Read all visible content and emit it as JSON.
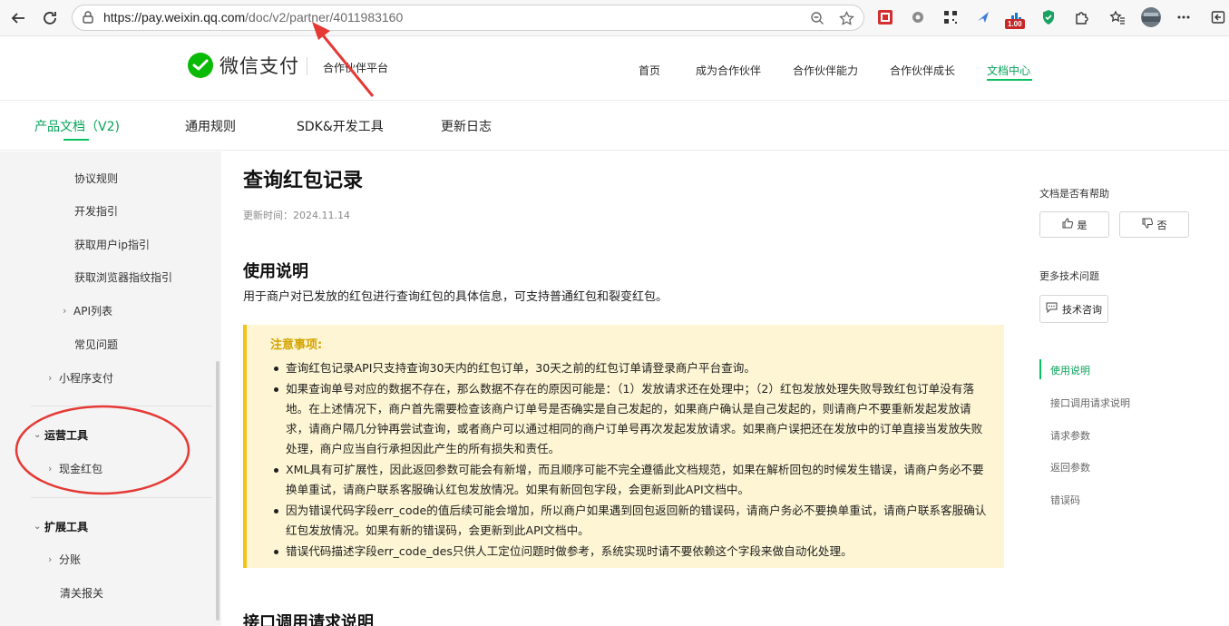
{
  "browser": {
    "url_host": "https://pay.weixin.qq.com",
    "url_path": "/doc/v2/partner/4011983160",
    "ext_badge": "1.00"
  },
  "site": {
    "logo_text": "微信支付",
    "subtitle": "合作伙伴平台",
    "nav": [
      "首页",
      "成为合作伙伴",
      "合作伙伴能力",
      "合作伙伴成长",
      "文档中心"
    ],
    "active_nav": "文档中心",
    "brand_color": "#07c160"
  },
  "sub_nav": [
    "产品文档（V2)",
    "通用规则",
    "SDK&开发工具",
    "更新日志"
  ],
  "sidebar": {
    "items": [
      {
        "label": "协议规则"
      },
      {
        "label": "开发指引"
      },
      {
        "label": "获取用户ip指引"
      },
      {
        "label": "获取浏览器指纹指引"
      },
      {
        "label": "API列表"
      },
      {
        "label": "常见问题"
      },
      {
        "label": "小程序支付"
      },
      {
        "label": "运营工具"
      },
      {
        "label": "现金红包"
      },
      {
        "label": "扩展工具"
      },
      {
        "label": "分账"
      },
      {
        "label": "清关报关"
      }
    ]
  },
  "content": {
    "title": "查询红包记录",
    "update_time": "更新时间：2024.11.14",
    "section1_title": "使用说明",
    "section1_desc": "用于商户对已发放的红包进行查询红包的具体信息，可支持普通红包和裂变红包。",
    "notice_title": "注意事项:",
    "notice_items": [
      "查询红包记录API只支持查询30天内的红包订单，30天之前的红包订单请登录商户平台查询。",
      "如果查询单号对应的数据不存在，那么数据不存在的原因可能是：（1）发放请求还在处理中；（2）红包发放处理失败导致红包订单没有落地。在上述情况下，商户首先需要检查该商户订单号是否确实是自己发起的，如果商户确认是自己发起的，则请商户不要重新发起发放请求，请商户隔几分钟再尝试查询，或者商户可以通过相同的商户订单号再次发起发放请求。如果商户误把还在发放中的订单直接当发放失败处理，商户应当自行承担因此产生的所有损失和责任。",
      "XML具有可扩展性，因此返回参数可能会有新增，而且顺序可能不完全遵循此文档规范，如果在解析回包的时候发生错误，请商户务必不要换单重试，请商户联系客服确认红包发放情况。如果有新回包字段，会更新到此API文档中。",
      "因为错误代码字段err_code的值后续可能会增加，所以商户如果遇到回包返回新的错误码，请商户务必不要换单重试，请商户联系客服确认红包发放情况。如果有新的错误码，会更新到此API文档中。",
      "错误代码描述字段err_code_des只供人工定位问题时做参考，系统实现时请不要依赖这个字段来做自动化处理。"
    ],
    "section2_title": "接口调用请求说明"
  },
  "rail": {
    "helpful_label": "文档是否有帮助",
    "yes_label": "是",
    "no_label": "否",
    "more_label": "更多技术问题",
    "consult_label": "技术咨询",
    "toc": [
      "使用说明",
      "接口调用请求说明",
      "请求参数",
      "返回参数",
      "错误码"
    ],
    "active_toc": "使用说明"
  }
}
